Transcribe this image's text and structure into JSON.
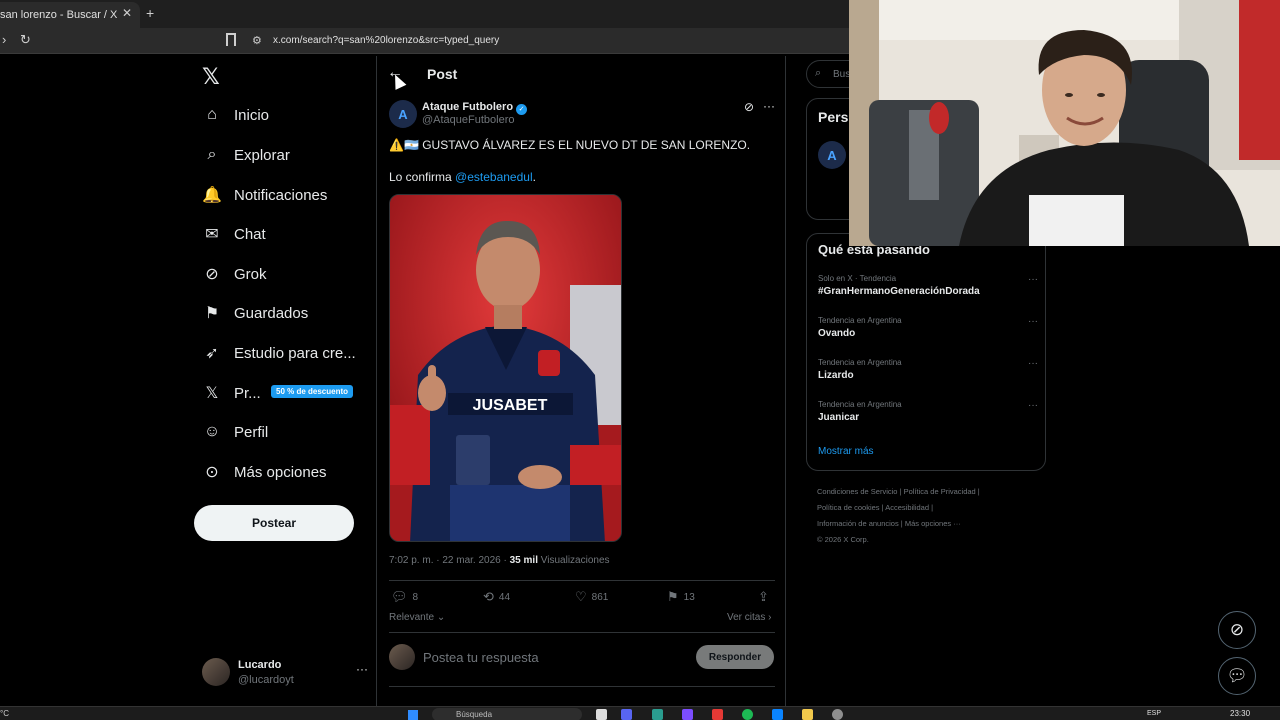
{
  "browser": {
    "tab_title": "san lorenzo - Buscar / X",
    "tab_close": "✕",
    "new_tab": "+",
    "url": "x.com/search?q=san%20lorenzo&src=typed_query"
  },
  "nav": {
    "items": [
      {
        "label": "Inicio",
        "icon": "home-icon",
        "glyph": "⌂"
      },
      {
        "label": "Explorar",
        "icon": "search-icon",
        "glyph": "⌕"
      },
      {
        "label": "Notificaciones",
        "icon": "bell-icon",
        "glyph": "🔔"
      },
      {
        "label": "Chat",
        "icon": "mail-icon",
        "glyph": "✉"
      },
      {
        "label": "Grok",
        "icon": "grok-icon",
        "glyph": "⊘"
      },
      {
        "label": "Guardados",
        "icon": "bookmark-icon",
        "glyph": "⚑"
      },
      {
        "label": "Estudio para cre...",
        "icon": "rocket-icon",
        "glyph": "➶"
      },
      {
        "label": "Pr...",
        "icon": "x-premium-icon",
        "glyph": "𝕏"
      },
      {
        "label": "Perfil",
        "icon": "person-icon",
        "glyph": "☺"
      },
      {
        "label": "Más opciones",
        "icon": "more-circle-icon",
        "glyph": "⊙"
      }
    ],
    "promo_badge": "50 % de descuento",
    "post_button": "Postear",
    "user": {
      "name": "Lucardo",
      "handle": "@lucardoyt"
    }
  },
  "post": {
    "header_title": "Post",
    "author_name": "Ataque Futbolero",
    "author_handle": "@AtaqueFutbolero",
    "text_line_1": "⚠️🇦🇷 GUSTAVO ÁLVAREZ ES EL NUEVO DT DE SAN LORENZO.",
    "text_line_2_prefix": "Lo confirma ",
    "mention": "@estebanedul",
    "text_line_2_suffix": ".",
    "image_sponsor": "JUSABET",
    "timestamp": "7:02 p. m. · 22 mar. 2026 · ",
    "views_count": "35 mil",
    "views_label": " Visualizaciones",
    "actions": {
      "replies": "8",
      "reposts": "44",
      "likes": "861",
      "bookmarks": "13"
    },
    "sort_label": "Relevante",
    "quotes_label": "Ver citas",
    "reply_placeholder": "Postea tu respuesta",
    "reply_button": "Responder"
  },
  "sidebar": {
    "search_placeholder": "Buscar",
    "premium_title": "Pers",
    "trends_title": "Qué está pasando",
    "trends": [
      {
        "meta": "Solo en X · Tendencia",
        "name": "#GranHermanoGeneraciónDorada"
      },
      {
        "meta": "Tendencia en Argentina",
        "name": "Ovando"
      },
      {
        "meta": "Tendencia en Argentina",
        "name": "Lizardo"
      },
      {
        "meta": "Tendencia en Argentina",
        "name": "Juanicar"
      }
    ],
    "show_more": "Mostrar más",
    "footer": [
      "Condiciones de Servicio",
      "Política de Privacidad",
      "Política de cookies",
      "Accesibilidad",
      "Información de anuncios",
      "Más opciones ···",
      "© 2026 X Corp."
    ]
  },
  "taskbar": {
    "search_label": "Búsqueda",
    "lang": "ESP",
    "time": "23:30"
  },
  "colors": {
    "accent": "#1d9bf0",
    "background": "#000000",
    "border": "#2f3336",
    "muted": "#71767b"
  }
}
